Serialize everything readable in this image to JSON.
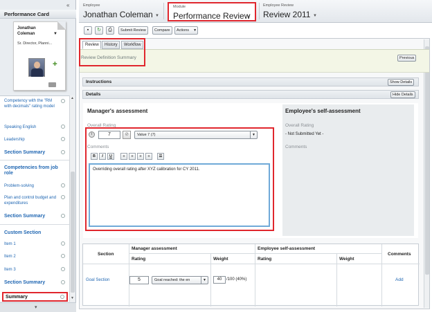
{
  "sidebar": {
    "title": "Performance Card",
    "collapse_glyph": "«",
    "card": {
      "first_name": "Jonathan",
      "last_name": "Coleman",
      "job_title": "Sr. Director, Planni..."
    },
    "items": [
      {
        "label": "Competency with the \"RM with decimals\" rating model",
        "kind": "item"
      },
      {
        "label": "Speaking English",
        "kind": "item"
      },
      {
        "label": "Leadership",
        "kind": "item"
      },
      {
        "label": "Section Summary",
        "kind": "summary"
      },
      {
        "label": "Competencies from job role",
        "kind": "head"
      },
      {
        "label": "Problem-solving",
        "kind": "item"
      },
      {
        "label": "Plan and control budget and expenditures",
        "kind": "item"
      },
      {
        "label": "Section Summary",
        "kind": "summary"
      },
      {
        "label": "Custom Section",
        "kind": "head"
      },
      {
        "label": "Item 1",
        "kind": "item"
      },
      {
        "label": "Item 2",
        "kind": "item"
      },
      {
        "label": "Item 3",
        "kind": "item"
      },
      {
        "label": "Section Summary",
        "kind": "summary"
      }
    ],
    "selected": "Summary"
  },
  "header": {
    "employee_label": "Employee",
    "employee_value": "Jonathan Coleman",
    "module_label": "Module",
    "module_value": "Performance Review",
    "review_label": "Employee Review",
    "review_value": "Review 2011"
  },
  "toolbar": {
    "submit_review": "Submit Review",
    "compare": "Compare",
    "actions": "Actions"
  },
  "tabs": [
    "Review",
    "History",
    "Workflow"
  ],
  "active_tab": "Review",
  "review_definition_summary": "Review Definition Summary",
  "previous_button": "Previous",
  "instructions": {
    "title": "Instructions",
    "button": "Show Details"
  },
  "details": {
    "title": "Details",
    "button": "Hide Details"
  },
  "manager": {
    "heading": "Manager's assessment",
    "overall_rating_label": "Overall Rating",
    "rating_value": "7",
    "rating_select": "Value 7 (7)",
    "comments_label": "Comments",
    "comment_text": "Overriding overall rating after XYZ calibration for CY 2011."
  },
  "employee": {
    "heading": "Employee's self-assessment",
    "overall_rating_label": "Overall Rating",
    "rating_value": "- Not Submitted Yet -",
    "comments_label": "Comments"
  },
  "table": {
    "section_header": "Section",
    "manager_assessment": "Manager assessment",
    "employee_self_assessment": "Employee self-assessment",
    "comments_header": "Comments",
    "rating_header": "Rating",
    "weight_header": "Weight",
    "rows": [
      {
        "section": "Goal Section",
        "rating": "5",
        "rating_select": "Goal reached: the en",
        "weight": "40",
        "weight_suffix": "/100 (40%)",
        "comments": "Add"
      }
    ]
  },
  "format_buttons": [
    "B",
    "I",
    "U",
    "≡",
    "≡",
    "≡",
    "≡",
    "☰"
  ]
}
